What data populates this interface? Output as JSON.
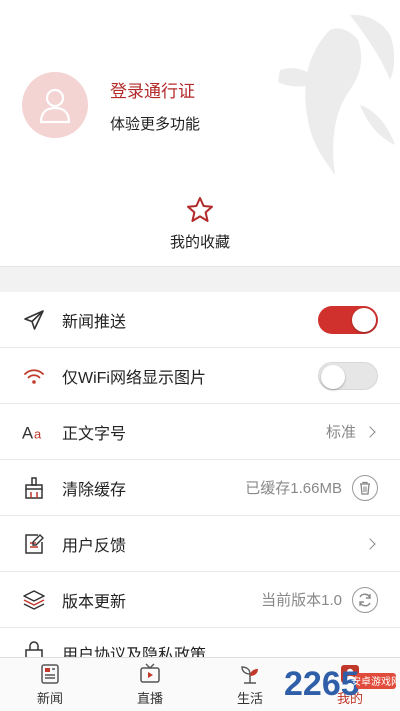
{
  "profile": {
    "login_title": "登录通行证",
    "login_subtitle": "体验更多功能"
  },
  "favorites": {
    "label": "我的收藏",
    "icon": "star-icon"
  },
  "settings": [
    {
      "label": "新闻推送",
      "icon": "send-icon",
      "control": "toggle",
      "on": true
    },
    {
      "label": "仅WiFi网络显示图片",
      "icon": "wifi-icon",
      "control": "toggle",
      "on": false
    },
    {
      "label": "正文字号",
      "icon": "font-size-icon",
      "value": "标准",
      "control": "chevron"
    },
    {
      "label": "清除缓存",
      "icon": "broom-icon",
      "value": "已缓存1.66MB",
      "control": "trash"
    },
    {
      "label": "用户反馈",
      "icon": "edit-icon",
      "control": "chevron"
    },
    {
      "label": "版本更新",
      "icon": "layers-icon",
      "value": "当前版本1.0",
      "control": "refresh"
    },
    {
      "label": "用户协议及隐私政策",
      "icon": "lock-icon",
      "control": "chevron"
    }
  ],
  "tabbar": [
    {
      "label": "新闻",
      "icon": "newspaper-icon",
      "active": false
    },
    {
      "label": "直播",
      "icon": "tv-icon",
      "active": false
    },
    {
      "label": "生活",
      "icon": "sprout-icon",
      "active": false
    },
    {
      "label": "我的",
      "icon": "user-icon",
      "active": true
    }
  ],
  "watermark": {
    "text": "2265",
    "subtext": "安卓游戏网"
  },
  "colors": {
    "accent": "#d0312d",
    "avatar_bg": "#f4d3d3",
    "gap_bg": "#f2f2f2"
  }
}
